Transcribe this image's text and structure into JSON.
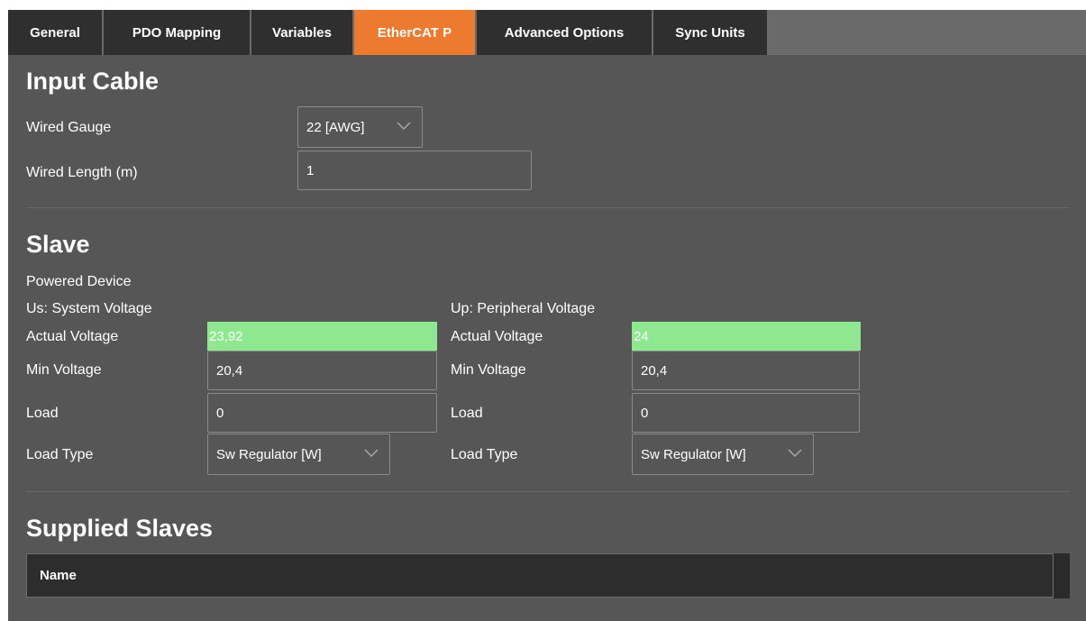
{
  "tabs": [
    {
      "label": "General"
    },
    {
      "label": "PDO Mapping"
    },
    {
      "label": "Variables"
    },
    {
      "label": "EtherCAT P"
    },
    {
      "label": "Advanced Options"
    },
    {
      "label": "Sync Units"
    }
  ],
  "active_tab": "EtherCAT P",
  "input_cable": {
    "title": "Input Cable",
    "gauge_label": "Wired Gauge",
    "gauge_value": "22 [AWG]",
    "length_label": "Wired Length (m)",
    "length_value": "1"
  },
  "slave": {
    "title": "Slave",
    "powered_device_label": "Powered Device",
    "us": {
      "title": "Us: System Voltage",
      "actual_label": "Actual Voltage",
      "actual_value": "23,92",
      "min_label": "Min Voltage",
      "min_value": "20,4",
      "load_label": "Load",
      "load_value": "0",
      "load_type_label": "Load Type",
      "load_type_value": "Sw Regulator [W]"
    },
    "up": {
      "title": "Up: Peripheral Voltage",
      "actual_label": "Actual Voltage",
      "actual_value": "24",
      "min_label": "Min Voltage",
      "min_value": "20,4",
      "load_label": "Load",
      "load_value": "0",
      "load_type_label": "Load Type",
      "load_type_value": "Sw Regulator [W]"
    }
  },
  "supplied_slaves": {
    "title": "Supplied Slaves",
    "columns": [
      "Name"
    ]
  },
  "colors": {
    "accent": "#ee7a2f",
    "ok_voltage": "#8ee88f",
    "background": "#565656",
    "tab_bg": "#2f2f2f"
  },
  "icons": {
    "dropdown": "chevron-down-icon"
  }
}
